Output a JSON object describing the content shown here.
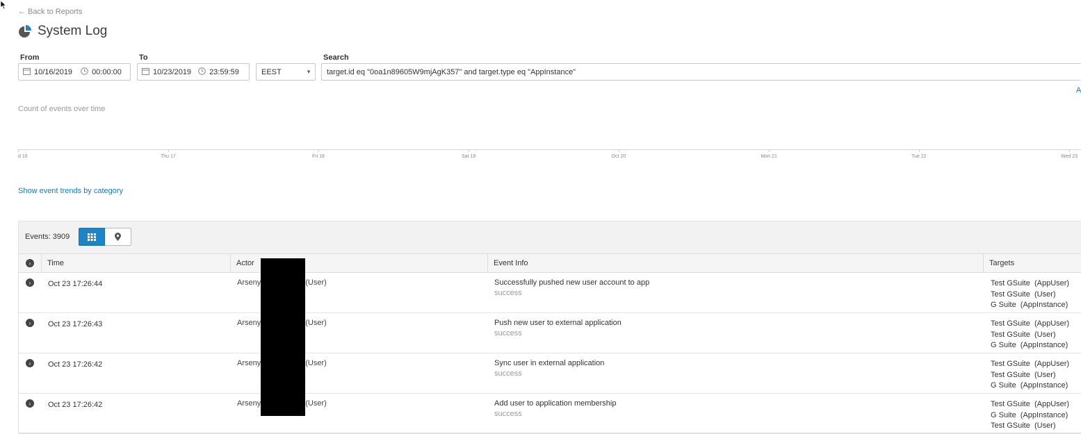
{
  "nav": {
    "back_label": "← Back to Reports"
  },
  "page": {
    "title": "System Log",
    "icon": "pie-chart-icon"
  },
  "filters": {
    "from_label": "From",
    "from_date": "10/16/2019",
    "from_time": "00:00:00",
    "to_label": "To",
    "to_date": "10/23/2019",
    "to_time": "23:59:59",
    "timezone": "EEST",
    "search_label": "Search",
    "search_value": "target.id eq \"0oa1n89605W9mjAgK357\" and target.type eq \"AppInstance\"",
    "advanced_fragment": "A"
  },
  "chart": {
    "title": "Count of events over time",
    "tick_labels": [
      "d 16",
      "Thu 17",
      "Fri 18",
      "Sat 19",
      "Oct 20",
      "Mon 21",
      "Tue 22",
      "Wed 23"
    ]
  },
  "trends_link": "Show event trends by category",
  "events": {
    "count_label": "Events: 3909",
    "grid_view_icon": "grid-icon",
    "map_view_icon": "map-pin-icon"
  },
  "table": {
    "columns": [
      "Time",
      "Actor",
      "Event Info",
      "Targets"
    ],
    "rows": [
      {
        "time": "Oct 23 17:26:44",
        "actor_first": "Arseny",
        "actor_type": "(User)",
        "event": "Successfully pushed new user account to app",
        "outcome": "success",
        "targets": [
          "Test GSuite  (AppUser)",
          "Test GSuite  (User)",
          "G Suite  (AppInstance)"
        ]
      },
      {
        "time": "Oct 23 17:26:43",
        "actor_first": "Arseny",
        "actor_type": "(User)",
        "event": "Push new user to external application",
        "outcome": "success",
        "targets": [
          "Test GSuite  (AppUser)",
          "Test GSuite  (User)",
          "G Suite  (AppInstance)"
        ]
      },
      {
        "time": "Oct 23 17:26:42",
        "actor_first": "Arseny",
        "actor_type": "(User)",
        "event": "Sync user in external application",
        "outcome": "success",
        "targets": [
          "Test GSuite  (AppUser)",
          "Test GSuite  (User)",
          "G Suite  (AppInstance)"
        ]
      },
      {
        "time": "Oct 23 17:26:42",
        "actor_first": "Arseny",
        "actor_type": "(User)",
        "event": "Add user to application membership",
        "outcome": "success",
        "targets": [
          "Test GSuite  (AppUser)",
          "G Suite  (AppInstance)",
          "Test GSuite  (User)"
        ]
      }
    ]
  },
  "colors": {
    "accent": "#1d84c6",
    "link": "#1a7ab5",
    "redaction": "#000000"
  }
}
